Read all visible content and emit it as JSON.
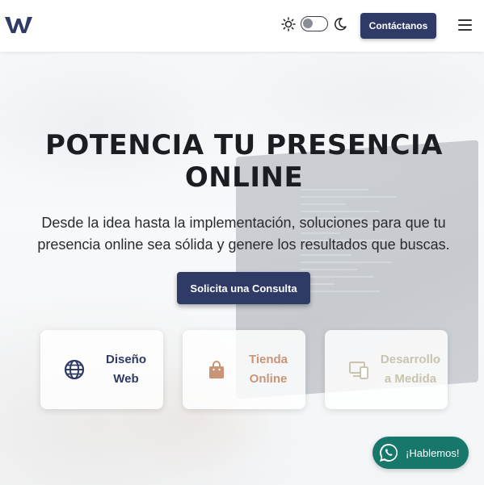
{
  "header": {
    "logo_alt": "W",
    "contact_label": "Contáctanos",
    "theme": {
      "dark_mode": false
    }
  },
  "hero": {
    "title": "POTENCIA TU PRESENCIA ONLINE",
    "subtitle": "Desde la idea hasta la implementación, soluciones para que tu presencia online sea sólida y genere los resultados que buscas.",
    "cta_label": "Solicita una Consulta",
    "services": [
      {
        "label": "Diseño Web",
        "icon": "globe-icon",
        "color": "#2f3a66"
      },
      {
        "label": "Tienda Online",
        "icon": "shopping-bag-icon",
        "color": "#c99576"
      },
      {
        "label": "Desarrollo a Medida",
        "icon": "devices-icon",
        "color": "#c8c4b0"
      }
    ]
  },
  "whatsapp": {
    "label": "¡Hablemos!",
    "color": "#16776a"
  },
  "colors": {
    "primary": "#2f3a66",
    "accent": "#c99576",
    "whatsapp": "#16776a"
  }
}
